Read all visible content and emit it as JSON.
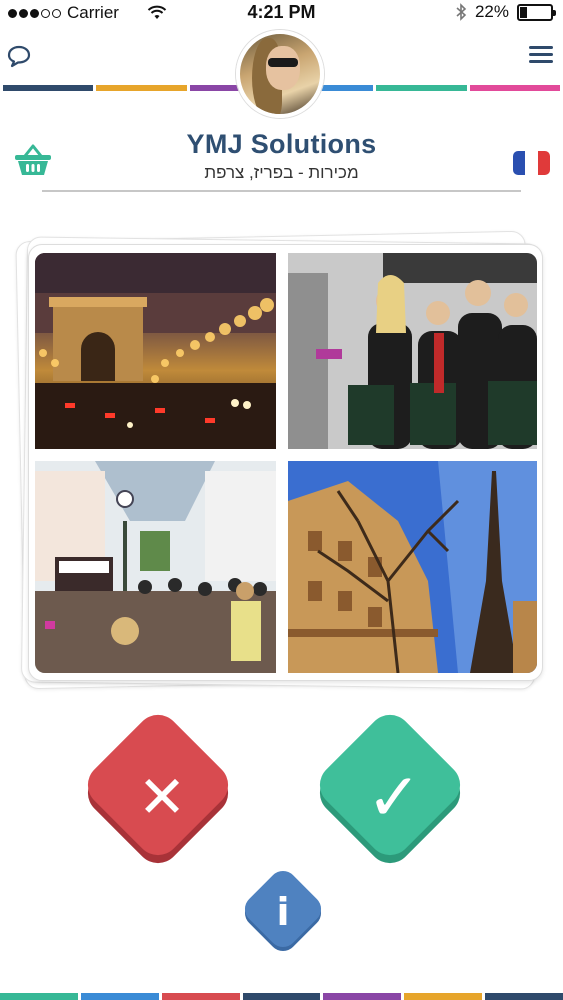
{
  "status_bar": {
    "carrier": "Carrier",
    "time": "4:21 PM",
    "battery": "22%",
    "battery_level": 0.22,
    "signal_bars_filled": 3,
    "signal_bars_total": 5
  },
  "header": {
    "title": "YMJ Solutions",
    "subtitle": "מכירות - בפריז, צרפת",
    "icons": {
      "chat": "chat-bubble-icon",
      "menu": "hamburger-menu-icon",
      "basket": "shopping-basket-icon",
      "language": "french-flag-icon"
    }
  },
  "colors": {
    "title": "#2f4f72",
    "stripe": [
      "#2f4a6b",
      "#e7a52b",
      "#8a46a6",
      "#3a8bd6",
      "#37b896",
      "#e24a9a"
    ],
    "bottom_stripe": [
      "#37b896",
      "#3a8bd6",
      "#d84b50",
      "#2f4a6b",
      "#8a46a6",
      "#e7a52b",
      "#2f4a6b"
    ],
    "reject": "#d84b50",
    "accept": "#3fbf9a",
    "info": "#4f82c0",
    "flag": [
      "#2a4fb0",
      "#ffffff",
      "#e03a3a"
    ]
  },
  "card": {
    "photos": [
      {
        "name": "arc-de-triomphe-night-photo"
      },
      {
        "name": "jose-eber-team-photo"
      },
      {
        "name": "shopping-mall-crowd-photo"
      },
      {
        "name": "eiffel-tower-photo"
      }
    ]
  },
  "actions": {
    "reject_icon": "close-x-icon",
    "accept_icon": "checkmark-icon",
    "info_icon": "info-icon",
    "reject_glyph": "✕",
    "accept_glyph": "✓",
    "info_glyph": "i"
  }
}
